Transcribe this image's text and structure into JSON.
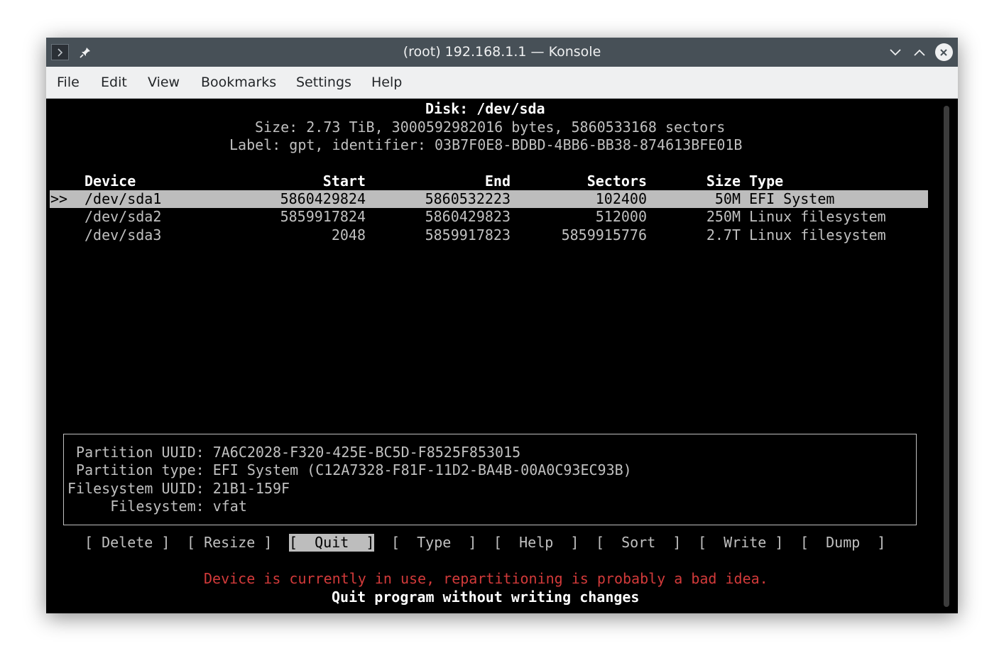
{
  "window": {
    "title": "(root) 192.168.1.1 — Konsole",
    "icons": [
      "terminal-app-icon",
      "pin-icon",
      "minimize-icon",
      "maximize-icon",
      "close-icon"
    ]
  },
  "menu": [
    "File",
    "Edit",
    "View",
    "Bookmarks",
    "Settings",
    "Help"
  ],
  "disk": {
    "title": "Disk: /dev/sda",
    "size_line": "Size: 2.73 TiB, 3000592982016 bytes, 5860533168 sectors",
    "label_line": "Label: gpt, identifier: 03B7F0E8-BDBD-4BB6-BB38-874613BFE01B"
  },
  "table": {
    "headers": {
      "device": "Device",
      "start": "Start",
      "end": "End",
      "sectors": "Sectors",
      "size": "Size",
      "type": "Type"
    },
    "selection_marker": ">>",
    "rows": [
      {
        "device": "/dev/sda1",
        "start": "5860429824",
        "end": "5860532223",
        "sectors": "102400",
        "size": "50M",
        "type": "EFI System"
      },
      {
        "device": "/dev/sda2",
        "start": "5859917824",
        "end": "5860429823",
        "sectors": "512000",
        "size": "250M",
        "type": "Linux filesystem"
      },
      {
        "device": "/dev/sda3",
        "start": "2048",
        "end": "5859917823",
        "sectors": "5859915776",
        "size": "2.7T",
        "type": "Linux filesystem"
      }
    ]
  },
  "info": {
    "line1": " Partition UUID: 7A6C2028-F320-425E-BC5D-F8525F853015",
    "line2": " Partition type: EFI System (C12A7328-F81F-11D2-BA4B-00A0C93EC93B)",
    "line3": "Filesystem UUID: 21B1-159F",
    "line4": "     Filesystem: vfat"
  },
  "actions": [
    {
      "label": "[ Delete ]"
    },
    {
      "label": "[ Resize ]"
    },
    {
      "label": "[  Quit  ]",
      "selected": true
    },
    {
      "label": "[  Type  ]"
    },
    {
      "label": "[  Help  ]"
    },
    {
      "label": "[  Sort  ]"
    },
    {
      "label": "[  Write ]"
    },
    {
      "label": "[  Dump  ]"
    }
  ],
  "messages": {
    "warning": "Device is currently in use, repartitioning is probably a bad idea.",
    "hint": "Quit program without writing changes"
  },
  "colors": {
    "selection": "#bdbdbd",
    "warning": "#d23a3a",
    "titlebar": "#475057",
    "menubar": "#eff0f1"
  }
}
